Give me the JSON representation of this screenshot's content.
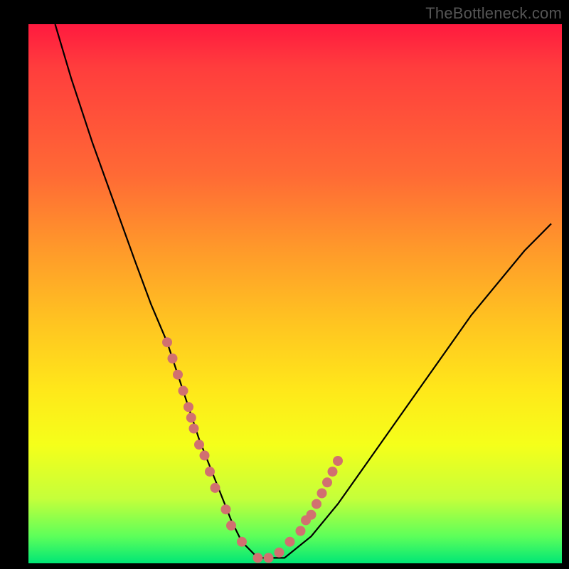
{
  "watermark": "TheBottleneck.com",
  "chart_data": {
    "type": "line",
    "title": "",
    "xlabel": "",
    "ylabel": "",
    "xlim": [
      0,
      100
    ],
    "ylim": [
      0,
      100
    ],
    "grid": false,
    "legend": false,
    "series": [
      {
        "name": "curve",
        "color": "#000000",
        "x": [
          5,
          8,
          12,
          16,
          20,
          23,
          26,
          28,
          30,
          32,
          34,
          36,
          38,
          40,
          43,
          48,
          53,
          58,
          63,
          68,
          73,
          78,
          83,
          88,
          93,
          98
        ],
        "y": [
          100,
          90,
          78,
          67,
          56,
          48,
          41,
          35,
          29,
          23,
          18,
          13,
          8,
          4,
          1,
          1,
          5,
          11,
          18,
          25,
          32,
          39,
          46,
          52,
          58,
          63
        ]
      },
      {
        "name": "dots",
        "color": "#d17070",
        "type": "scatter",
        "x": [
          26,
          27,
          28,
          29,
          30,
          30.5,
          31,
          32,
          33,
          34,
          35,
          37,
          38,
          40,
          43,
          45,
          47,
          49,
          51,
          52,
          53,
          54,
          55,
          56,
          57,
          58
        ],
        "y": [
          41,
          38,
          35,
          32,
          29,
          27,
          25,
          22,
          20,
          17,
          14,
          10,
          7,
          4,
          1,
          1,
          2,
          4,
          6,
          8,
          9,
          11,
          13,
          15,
          17,
          19
        ]
      }
    ]
  }
}
